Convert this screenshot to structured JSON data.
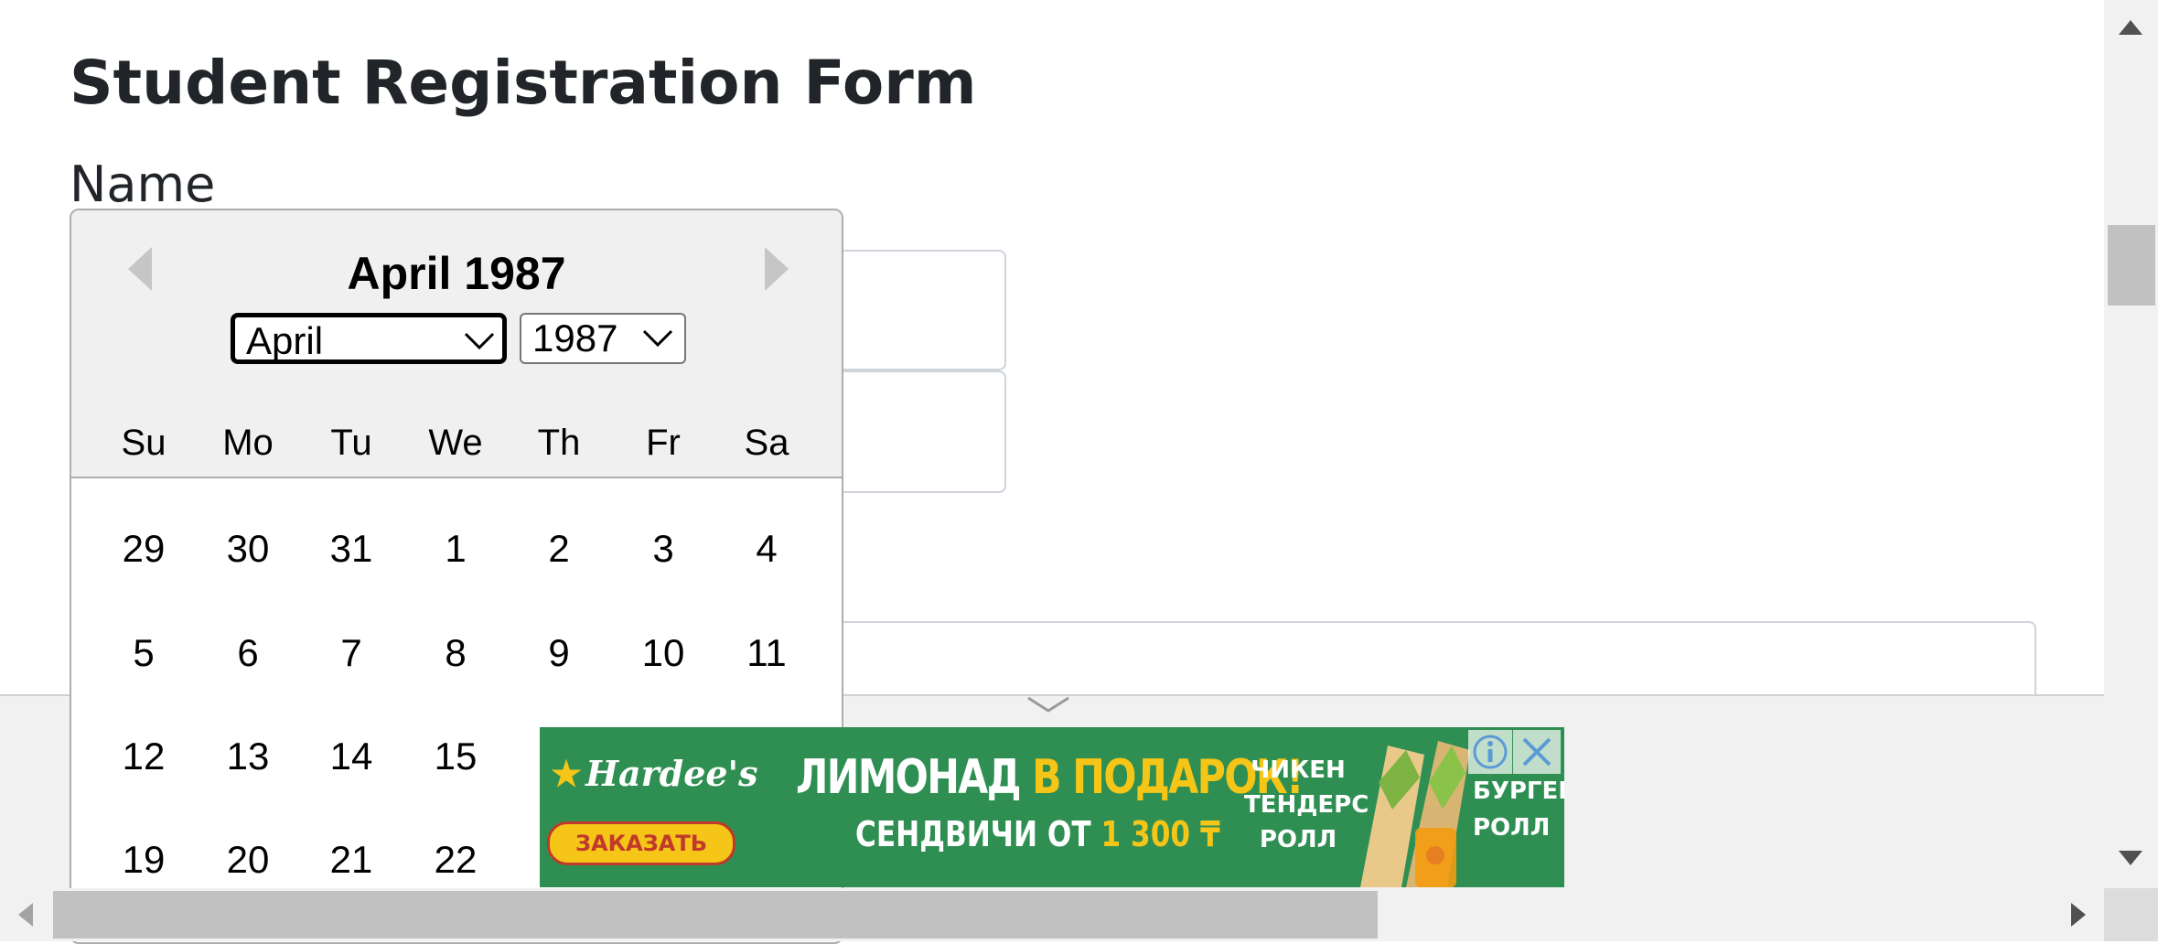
{
  "page": {
    "title": "Student Registration Form",
    "name_label": "Name"
  },
  "ad": {
    "brand": "Hardee's",
    "order_button": "ЗАКАЗАТЬ",
    "headline_white": "ЛИМОНАД",
    "headline_yellow": "В ПОДАРОК!",
    "subline_text": "СЕНДВИЧИ ОТ",
    "subline_price": "1 300 ₸",
    "product_left": "ЧИКЕН ТЕНДЕРС РОЛЛ",
    "product_right": "БУРГЕР РОЛЛ",
    "colors": {
      "background": "#2f8f52",
      "accent": "#f5c518",
      "button_border": "#c0392b"
    }
  },
  "datepicker": {
    "current_month_label": "April 1987",
    "month_select_value": "April",
    "year_select_value": "1987",
    "day_names": [
      "Su",
      "Mo",
      "Tu",
      "We",
      "Th",
      "Fr",
      "Sa"
    ],
    "weeks": [
      [
        "29",
        "30",
        "31",
        "1",
        "2",
        "3",
        "4"
      ],
      [
        "5",
        "6",
        "7",
        "8",
        "9",
        "10",
        "11"
      ],
      [
        "12",
        "13",
        "14",
        "15",
        "",
        "",
        ""
      ],
      [
        "19",
        "20",
        "21",
        "22",
        "",
        "",
        ""
      ]
    ],
    "icons": {
      "prev": "triangle-left-icon",
      "next": "triangle-right-icon"
    }
  },
  "scrollbars": {
    "vertical_icons": [
      "triangle-up-icon",
      "triangle-down-icon"
    ],
    "horizontal_icons": [
      "triangle-left-icon",
      "triangle-right-icon"
    ]
  }
}
